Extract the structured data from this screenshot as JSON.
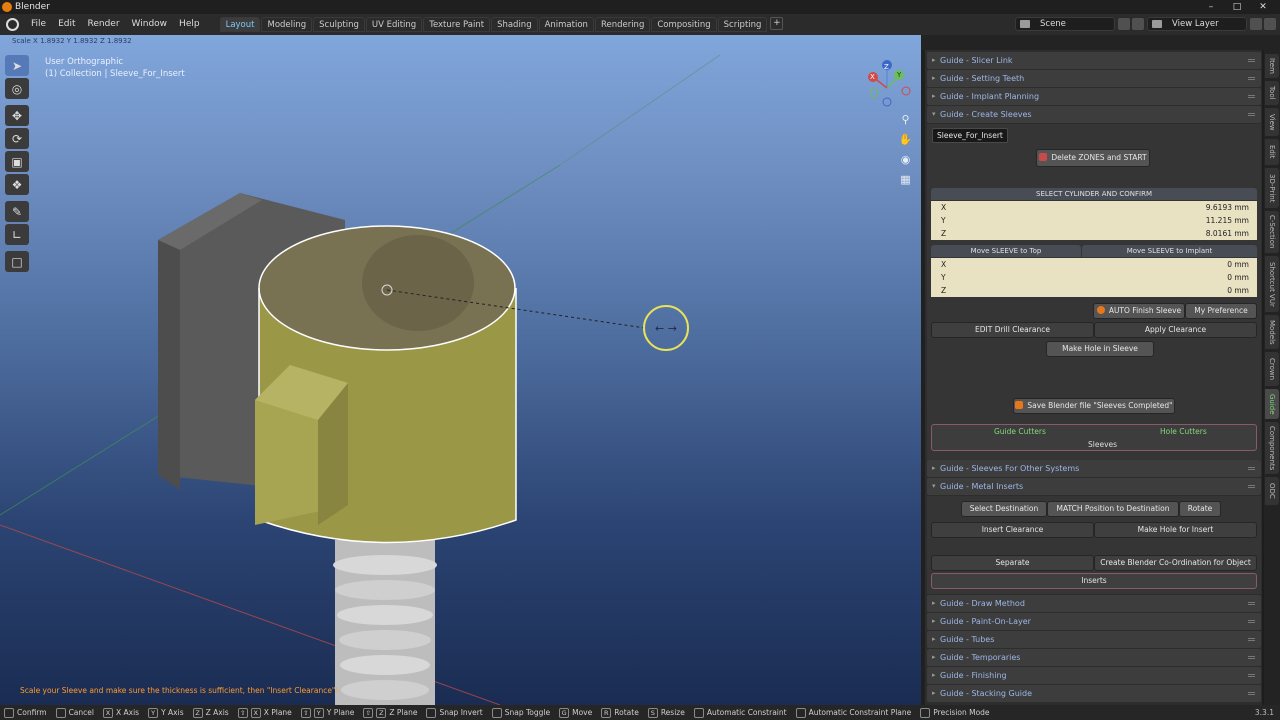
{
  "window": {
    "title": "Blender"
  },
  "menu": [
    "File",
    "Edit",
    "Render",
    "Window",
    "Help"
  ],
  "workspaces": [
    "Layout",
    "Modeling",
    "Sculpting",
    "UV Editing",
    "Texture Paint",
    "Shading",
    "Animation",
    "Rendering",
    "Compositing",
    "Scripting"
  ],
  "active_workspace": "Layout",
  "scene": {
    "scene_name": "Scene",
    "view_layer": "View Layer"
  },
  "viewport": {
    "header_text": "Scale X 1.8932 Y 1.8932 Z 1.8932",
    "view_name": "User Orthographic",
    "collection": "(1) Collection | Sleeve_For_Insert",
    "status_hint": "Scale your Sleeve and make sure the thickness is sufficient, then \"Insert Clearance\"!",
    "gizmo_axes": {
      "x": "X",
      "y": "Y",
      "z": "Z"
    },
    "colors": {
      "sleeve": "#9a9746",
      "sleeve_top": "#787152",
      "block": "#5a5a5a",
      "selection_outline": "#ffffff",
      "cursor_ring": "#e8e25a"
    }
  },
  "panel": {
    "sections_top": [
      "Guide - Slicer Link",
      "Guide - Setting Teeth",
      "Guide - Implant Planning"
    ],
    "create_sleeves": {
      "title": "Guide - Create Sleeves",
      "tooltip": "Sleeve_For_Insert",
      "delete_zones": "Delete ZONES and START",
      "select_cylinder": "SELECT CYLINDER AND CONFIRM",
      "location": {
        "x_label": "X",
        "x": "9.6193 mm",
        "y_label": "Y",
        "y": "11.215 mm",
        "z_label": "Z",
        "z": "8.0161 mm"
      },
      "move_top": "Move SLEEVE to Top",
      "move_implant": "Move SLEEVE to Implant",
      "offset": {
        "x_label": "X",
        "x": "0 mm",
        "y_label": "Y",
        "y": "0 mm",
        "z_label": "Z",
        "z": "0 mm"
      },
      "auto_finish": "AUTO Finish Sleeve",
      "my_preference": "My Preference",
      "edit_drill": "EDIT Drill Clearance",
      "apply_clearance": "Apply Clearance",
      "make_hole": "Make Hole in Sleeve",
      "save_file": "Save Blender file \"Sleeves Completed\"",
      "guide_cutters": "Guide Cutters",
      "hole_cutters": "Hole Cutters",
      "sleeves": "Sleeves"
    },
    "sleeves_other": "Guide - Sleeves For Other Systems",
    "metal_inserts": {
      "title": "Guide - Metal Inserts",
      "select_destination": "Select Destination",
      "match_position": "MATCH Position to Destination",
      "rotate": "Rotate",
      "insert_clearance": "Insert Clearance",
      "make_hole_insert": "Make Hole for Insert",
      "separate": "Separate",
      "create_coord": "Create Blender Co-Ordination for Object",
      "inserts": "Inserts"
    },
    "sections_bottom": [
      "Guide - Draw Method",
      "Guide - Paint-On-Layer",
      "Guide - Tubes",
      "Guide - Temporaries",
      "Guide - Finishing",
      "Guide - Stacking Guide"
    ]
  },
  "side_tabs": [
    "Item",
    "Tool",
    "View",
    "Edit",
    "3D-Print",
    "C-Section",
    "Shortcut VUr",
    "Models",
    "Crown",
    "Guide",
    "Components",
    "ODC"
  ],
  "active_side_tab": "Guide",
  "statusbar": {
    "items": [
      {
        "key": "",
        "label": "Confirm"
      },
      {
        "key": "",
        "label": "Cancel"
      },
      {
        "key": "X",
        "label": "X Axis"
      },
      {
        "key": "Y",
        "label": "Y Axis"
      },
      {
        "key": "Z",
        "label": "Z Axis"
      },
      {
        "key": "X",
        "label": "X Plane"
      },
      {
        "key": "Y",
        "label": "Y Plane"
      },
      {
        "key": "Z",
        "label": "Z Plane"
      },
      {
        "key": "",
        "label": "Snap Invert"
      },
      {
        "key": "",
        "label": "Snap Toggle"
      },
      {
        "key": "G",
        "label": "Move"
      },
      {
        "key": "R",
        "label": "Rotate"
      },
      {
        "key": "S",
        "label": "Resize"
      },
      {
        "key": "",
        "label": "Automatic Constraint"
      },
      {
        "key": "",
        "label": "Automatic Constraint Plane"
      },
      {
        "key": "",
        "label": "Precision Mode"
      }
    ],
    "version": "3.3.1"
  }
}
